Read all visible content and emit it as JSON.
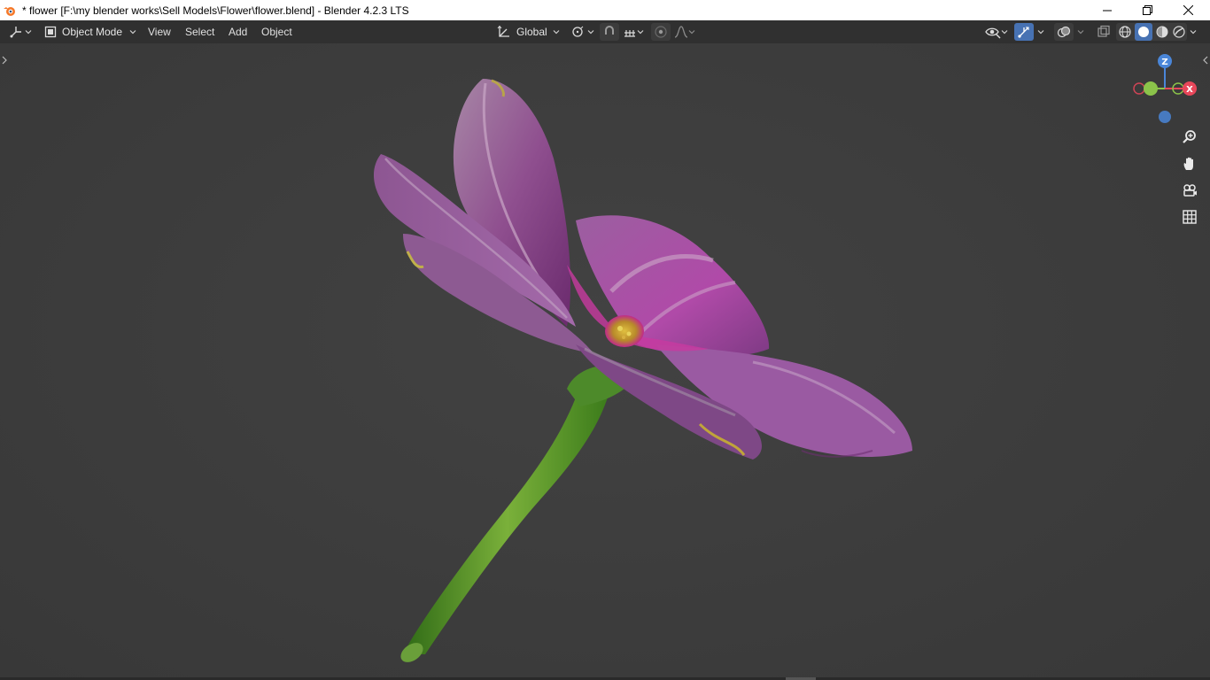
{
  "window": {
    "title": "* flower [F:\\my blender works\\Sell Models\\Flower\\flower.blend] - Blender 4.2.3 LTS",
    "icons": {
      "app": "blender-logo-icon",
      "minimize": "minimize-icon",
      "restore": "restore-icon",
      "close": "close-icon"
    }
  },
  "header": {
    "editor_type_icon": "editor-type-3d-viewport-icon",
    "mode": {
      "label": "Object Mode",
      "icon": "object-mode-icon"
    },
    "menus": [
      "View",
      "Select",
      "Add",
      "Object"
    ],
    "transform_orientation": {
      "label": "Global",
      "icon": "orientation-icon"
    },
    "icons": {
      "pivot": "pivot-point-icon",
      "snap": "snap-magnet-icon",
      "snap_target": "snap-increment-icon",
      "proportional": "proportional-editing-icon",
      "falloff": "falloff-curve-icon",
      "visibility": "object-visibility-eye-icon",
      "gizmos": "gizmo-toggle-icon",
      "overlays": "overlays-icon",
      "xray": "xray-toggle-icon",
      "shading_wire": "wireframe-shading-icon",
      "shading_solid": "solid-shading-icon",
      "shading_material": "material-preview-icon",
      "shading_rendered": "rendered-shading-icon"
    }
  },
  "viewport": {
    "gizmo_axes": {
      "z": "Z",
      "y": "Y",
      "x": "X"
    },
    "nav_icons": [
      "zoom-icon",
      "pan-hand-icon",
      "camera-view-icon",
      "ortho-grid-icon"
    ],
    "colors": {
      "background": "#3d3d3d",
      "header": "#303030",
      "accent": "#4772b3",
      "x_axis": "#e8475a",
      "y_axis": "#8bc34a",
      "z_axis": "#4a86d8"
    }
  }
}
